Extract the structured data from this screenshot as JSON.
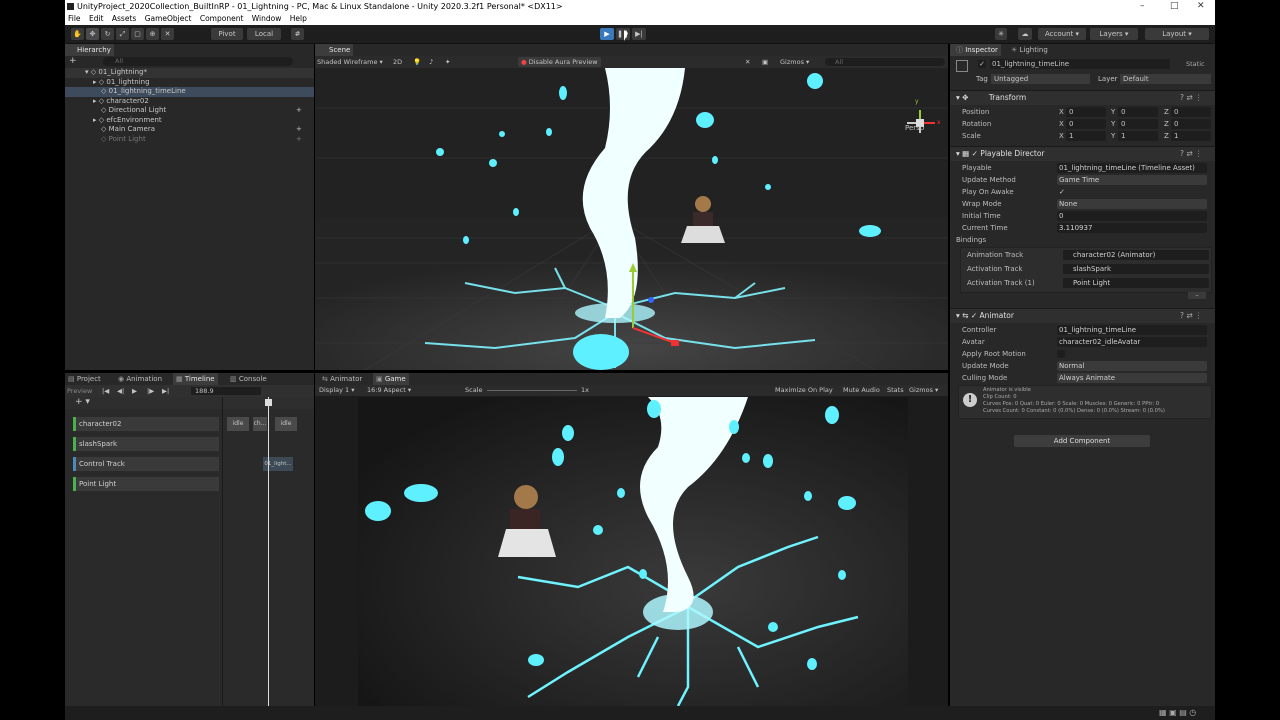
{
  "window": {
    "title": "UnityProject_2020Collection_BuiltInRP - 01_Lightning - PC, Mac & Linux Standalone - Unity 2020.3.2f1 Personal* <DX11>",
    "minimize": "–",
    "maximize": "□",
    "close": "✕"
  },
  "menu": [
    "File",
    "Edit",
    "Assets",
    "GameObject",
    "Component",
    "Window",
    "Help"
  ],
  "toolbar": {
    "pivot": "Pivot",
    "local": "Local",
    "account": "Account",
    "layers": "Layers",
    "layout": "Layout"
  },
  "hierarchy": {
    "tab": "Hierarchy",
    "search_placeholder": "All",
    "root": "01_Lightning*",
    "items": [
      "01_lightning",
      "01_lightning_timeLine",
      "character02",
      "Directional Light",
      "efcEnvironment",
      "Main Camera",
      "Point Light"
    ]
  },
  "scene": {
    "tab": "Scene",
    "shading": "Shaded Wireframe",
    "mode_2d": "2D",
    "aura": "Disable Aura Preview",
    "gizmos": "Gizmos",
    "search_placeholder": "All",
    "persp": "Persp"
  },
  "bottom_tabs": [
    "Project",
    "Animation",
    "Timeline",
    "Console"
  ],
  "timeline": {
    "preview": "Preview",
    "frame": "188.9",
    "tracks": [
      {
        "label": "character02",
        "clip_labels": [
          "idle",
          "ch...",
          "idle"
        ]
      },
      {
        "label": "slashSpark",
        "clip_labels": []
      },
      {
        "label": "Control Track",
        "clip_labels": [
          "01_light..."
        ]
      },
      {
        "label": "Point Light",
        "clip_labels": []
      }
    ]
  },
  "game_tabs": [
    "Animator",
    "Game"
  ],
  "game": {
    "display": "Display 1",
    "aspect": "16:9 Aspect",
    "scale_label": "Scale",
    "scale_value": "1x",
    "maximize": "Maximize On Play",
    "mute": "Mute Audio",
    "stats": "Stats",
    "gizmos": "Gizmos"
  },
  "inspector": {
    "tabs": [
      "Inspector",
      "Lighting"
    ],
    "object_name": "01_lightning_timeLine",
    "static": "Static",
    "tag_label": "Tag",
    "tag": "Untagged",
    "layer_label": "Layer",
    "layer": "Default",
    "transform": {
      "title": "Transform",
      "rows": [
        {
          "label": "Position",
          "x": "0",
          "y": "0",
          "z": "0"
        },
        {
          "label": "Rotation",
          "x": "0",
          "y": "0",
          "z": "0"
        },
        {
          "label": "Scale",
          "x": "1",
          "y": "1",
          "z": "1"
        }
      ]
    },
    "playable_director": {
      "title": "Playable Director",
      "rows": [
        {
          "label": "Playable",
          "value": "01_lightning_timeLine (Timeline Asset)"
        },
        {
          "label": "Update Method",
          "value": "Game Time"
        },
        {
          "label": "Play On Awake",
          "value": "✓"
        },
        {
          "label": "Wrap Mode",
          "value": "None"
        },
        {
          "label": "Initial Time",
          "value": "0"
        },
        {
          "label": "Current Time",
          "value": "3.110937"
        }
      ],
      "bindings_label": "Bindings",
      "bindings": [
        {
          "label": "Animation Track",
          "value": "character02 (Animator)"
        },
        {
          "label": "Activation Track",
          "value": "slashSpark"
        },
        {
          "label": "Activation Track (1)",
          "value": "Point Light"
        }
      ]
    },
    "animator": {
      "title": "Animator",
      "rows": [
        {
          "label": "Controller",
          "value": "01_lightning_timeLine"
        },
        {
          "label": "Avatar",
          "value": "character02_idleAvatar"
        },
        {
          "label": "Apply Root Motion",
          "value": ""
        },
        {
          "label": "Update Mode",
          "value": "Normal"
        },
        {
          "label": "Culling Mode",
          "value": "Always Animate"
        }
      ],
      "info": [
        "Animator is visible",
        "Clip Count: 0",
        "Curves Pos: 0 Quat: 0 Euler: 0 Scale: 0 Muscles: 0 Generic: 0 PPtr: 0",
        "Curves Count: 0 Constant: 0 (0.0%) Dense: 0 (0.0%) Stream: 0 (0.0%)"
      ]
    },
    "add_component": "Add Component"
  },
  "colors": {
    "cyan_glow": "#5ff0ff",
    "accent_blue": "#3a79bb",
    "track_green": "#4caf50"
  }
}
